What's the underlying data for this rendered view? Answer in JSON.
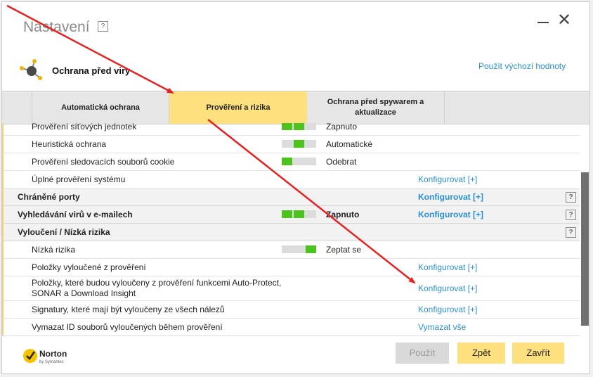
{
  "window": {
    "title": "Nastavení",
    "help": "?",
    "section_title": "Ochrana před viry",
    "defaults_link": "Použít výchozí hodnoty"
  },
  "tabs": [
    {
      "label": "Automatická ochrana"
    },
    {
      "label": "Prověření a rizika",
      "active": true
    },
    {
      "label": "Ochrana před spywarem a aktualizace"
    }
  ],
  "rows": [
    {
      "label": "Prověření síťových jednotek",
      "status": "Zapnuto",
      "slider": [
        1,
        1,
        0
      ]
    },
    {
      "label": "Heuristická ochrana",
      "status": "Automatické",
      "slider": [
        0,
        1,
        0
      ]
    },
    {
      "label": "Prověření sledovacích souborů cookie",
      "status": "Odebrat",
      "slider": [
        1,
        0,
        0
      ]
    },
    {
      "label": "Úplné prověření systému",
      "link": "Konfigurovat [+]"
    },
    {
      "label": "Chráněné porty",
      "group": true,
      "link": "Konfigurovat [+]",
      "help": "?"
    },
    {
      "label": "Vyhledávání virů v e-mailech",
      "group": true,
      "status": "Zapnuto",
      "slider": [
        1,
        1,
        0
      ],
      "link": "Konfigurovat [+]",
      "help": "?"
    },
    {
      "label": "Vyloučení / Nízká rizika",
      "group": true,
      "help": "?"
    },
    {
      "label": "Nízká rizika",
      "status": "Zeptat se",
      "slider": [
        0,
        0,
        1
      ]
    },
    {
      "label": "Položky vyloučené z prověření",
      "link": "Konfigurovat [+]"
    },
    {
      "label": "Položky, které budou vyloučeny z prověření funkcemi Auto-Protect, SONAR a Download Insight",
      "link": "Konfigurovat [+]",
      "two_line": true
    },
    {
      "label": "Signatury, které mají být vyloučeny ze všech nálezů",
      "link": "Konfigurovat [+]"
    },
    {
      "label": "Vymazat ID souborů vyloučených během prověření",
      "link": "Vymazat vše"
    }
  ],
  "footer": {
    "brand": "Norton",
    "brand_sub": "by Symantec",
    "apply": "Použít",
    "back": "Zpět",
    "close": "Zavřít"
  },
  "colors": {
    "accent_yellow": "#ffe07f",
    "link_blue": "#2a8fcf",
    "slider_green": "#4cc21c",
    "annotation_red": "#e8201f"
  }
}
